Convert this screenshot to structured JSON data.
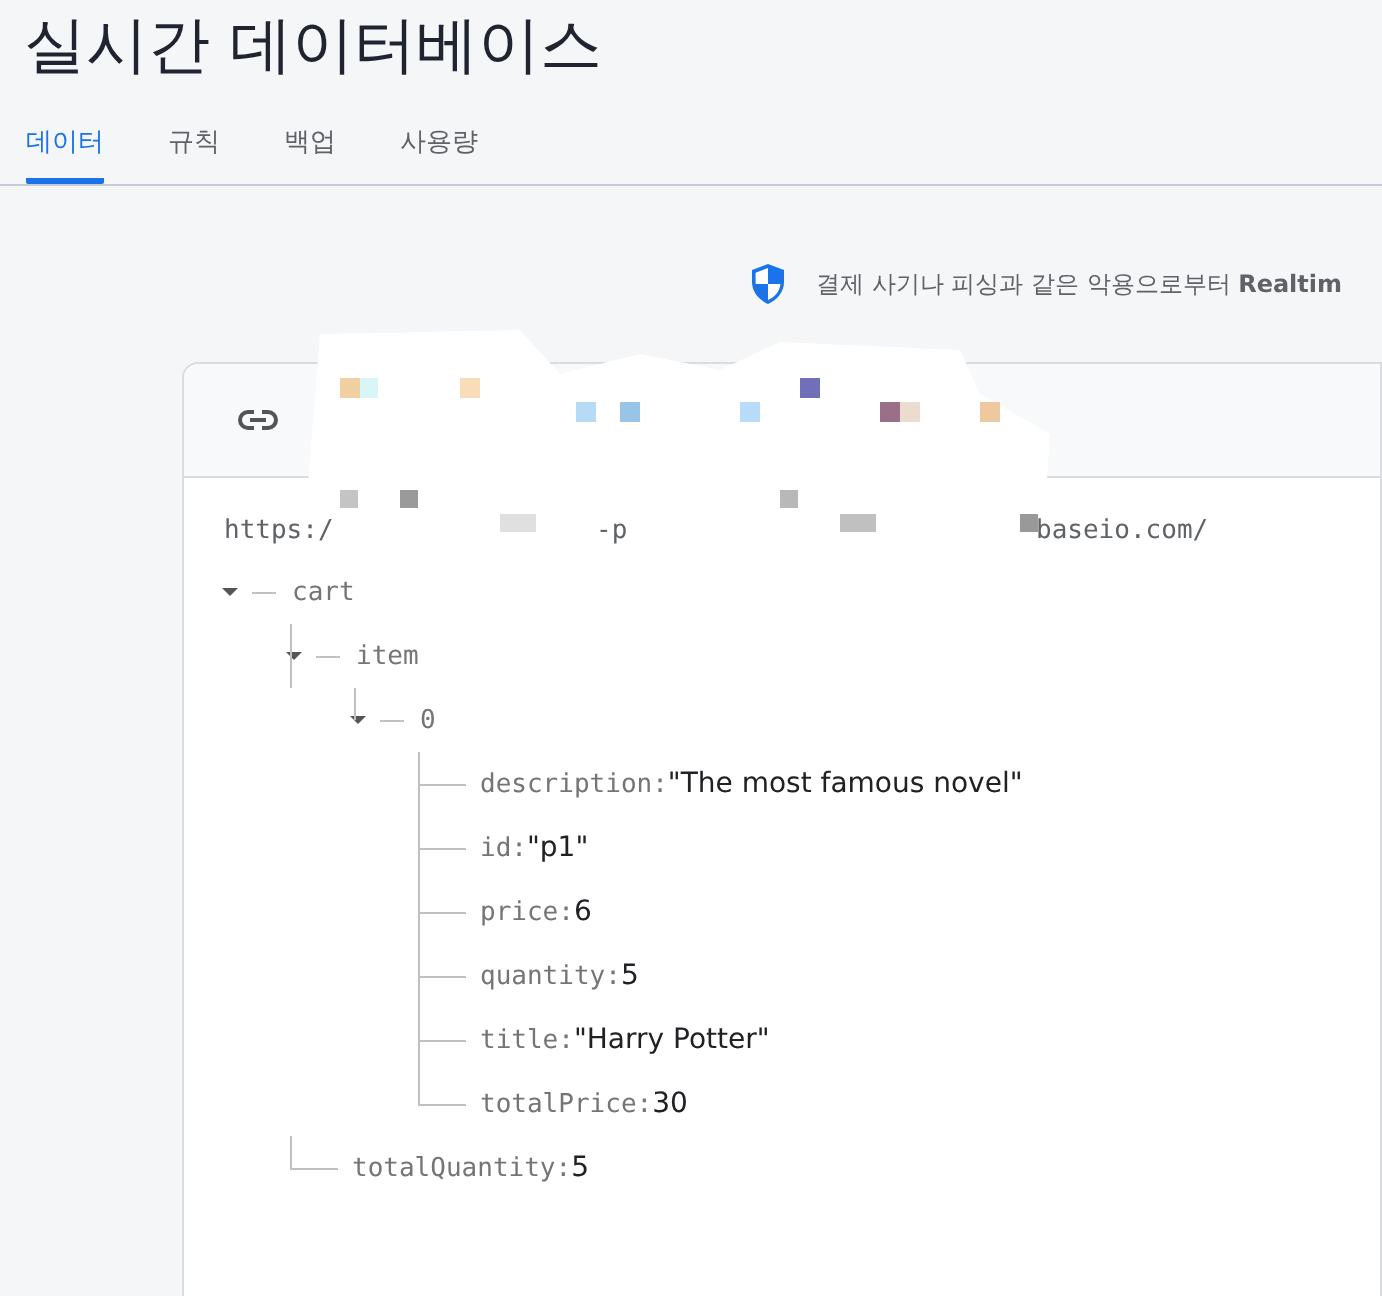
{
  "page_title": "실시간 데이터베이스",
  "tabs": [
    {
      "label": "데이터",
      "selected": true
    },
    {
      "label": "규칙",
      "selected": false
    },
    {
      "label": "백업",
      "selected": false
    },
    {
      "label": "사용량",
      "selected": false
    }
  ],
  "banner": {
    "text": "결제 사기나 피싱과 같은 악용으로부터 **Realtim**"
  },
  "database_url": [
    "https:/",
    "-p",
    "baseio.com/"
  ],
  "tree": [
    {
      "key": "cart",
      "expanded": true,
      "children": [
        {
          "key": "item",
          "expanded": true,
          "children": [
            {
              "key": "0",
              "expanded": true,
              "children": [
                {
                  "key": "description:",
                  "value": "\"The most famous novel\""
                },
                {
                  "key": "id:",
                  "value": "\"p1\""
                },
                {
                  "key": "price:",
                  "value": "6"
                },
                {
                  "key": "quantity:",
                  "value": "5"
                },
                {
                  "key": "title:",
                  "value": "\"Harry Potter\""
                },
                {
                  "key": "totalPrice:",
                  "value": "30"
                }
              ]
            }
          ]
        },
        {
          "key": "totalQuantity:",
          "value": "5"
        }
      ]
    }
  ]
}
